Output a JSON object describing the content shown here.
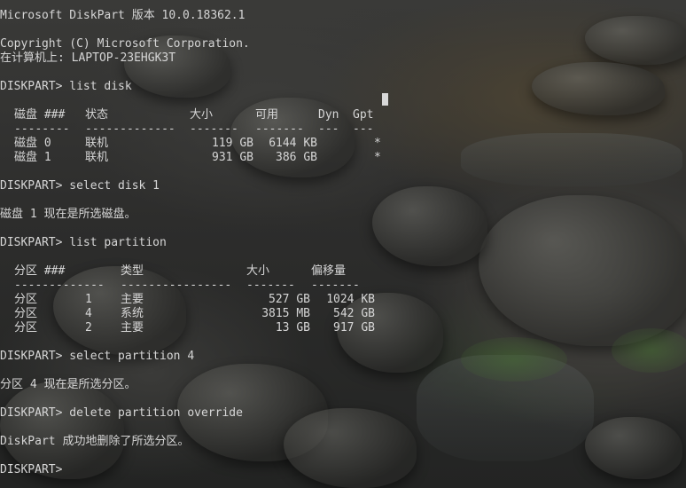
{
  "console": {
    "lines": {
      "header": "Microsoft DiskPart 版本 10.0.18362.1",
      "copyright": "Copyright (C) Microsoft Corporation.",
      "computer": "在计算机上: LAPTOP-23EHGK3T",
      "cmd_list_disk": "DISKPART> list disk",
      "cmd_select_disk": "DISKPART> select disk 1",
      "msg_disk_selected": "磁盘 1 现在是所选磁盘。",
      "cmd_list_partition": "DISKPART> list partition",
      "cmd_select_partition": "DISKPART> select partition 4",
      "msg_partition_selected": "分区 4 现在是所选分区。",
      "cmd_delete": "DISKPART> delete partition override",
      "msg_deleted": "DiskPart 成功地删除了所选分区。",
      "prompt": "DISKPART>"
    },
    "disk_table": {
      "headers": {
        "disk": "磁盘 ###",
        "status": "状态",
        "size": "大小",
        "free": "可用",
        "dyn": "Dyn",
        "gpt": "Gpt"
      },
      "separators": {
        "disk": "--------",
        "status": "-------------",
        "size": "-------",
        "free": "-------",
        "dyn": "---",
        "gpt": "---"
      },
      "rows": [
        {
          "disk": "磁盘 0",
          "status": "联机",
          "size": "119 GB",
          "free": "6144 KB",
          "dyn": "",
          "gpt": "*"
        },
        {
          "disk": "磁盘 1",
          "status": "联机",
          "size": "931 GB",
          "free": "386 GB",
          "dyn": "",
          "gpt": "*"
        }
      ]
    },
    "partition_table": {
      "headers": {
        "partition": "分区 ###",
        "type": "类型",
        "size": "大小",
        "offset": "偏移量"
      },
      "separators": {
        "partition": "-------------",
        "type": "----------------",
        "size": "-------",
        "offset": "-------"
      },
      "rows": [
        {
          "label": "分区",
          "num": "1",
          "type": "主要",
          "size": "527 GB",
          "offset": "1024 KB"
        },
        {
          "label": "分区",
          "num": "4",
          "type": "系统",
          "size": "3815 MB",
          "offset": "542 GB"
        },
        {
          "label": "分区",
          "num": "2",
          "type": "主要",
          "size": "13 GB",
          "offset": "917 GB"
        }
      ]
    }
  }
}
